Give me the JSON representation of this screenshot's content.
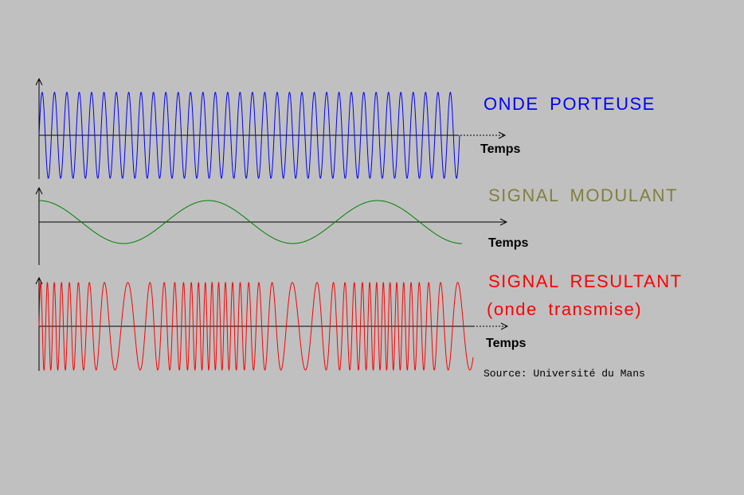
{
  "carrier": {
    "title": "ONDE PORTEUSE",
    "axis_label": "Temps",
    "color": "#0000ff",
    "cycles": 34
  },
  "modulating": {
    "title": "SIGNAL MODULANT",
    "axis_label": "Temps",
    "color": "#008000",
    "label_color": "#808040",
    "cycles": 2.5,
    "phase": "cosine"
  },
  "resultant": {
    "title": "SIGNAL RESULTANT",
    "subtitle": "(onde transmise)",
    "axis_label": "Temps",
    "color": "#ff0000",
    "modulation": "frequency"
  },
  "source": "Source: Université du Mans"
}
